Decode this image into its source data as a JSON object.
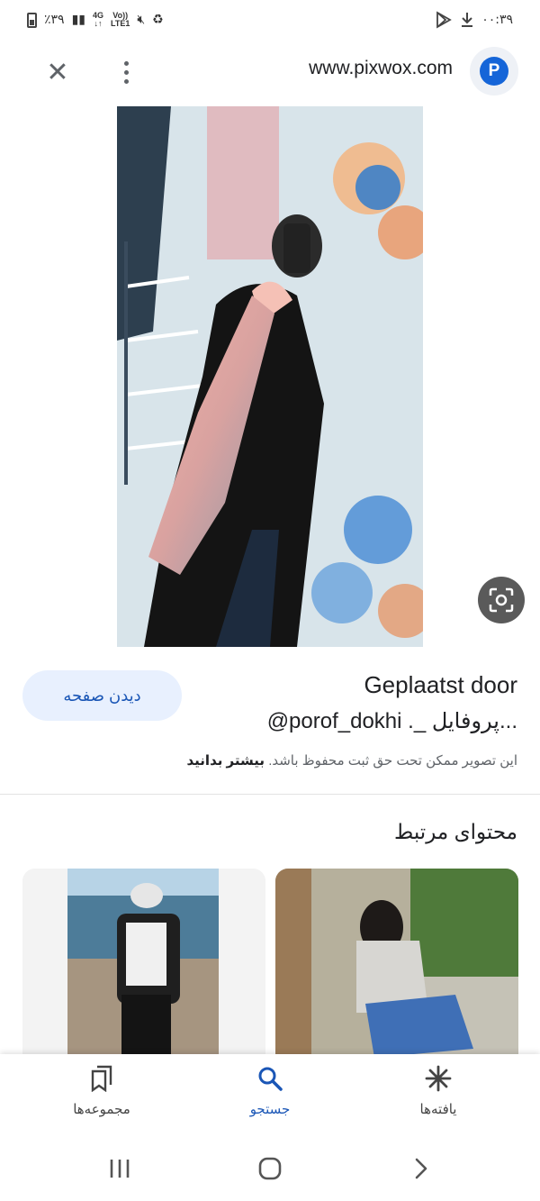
{
  "status_bar": {
    "battery_percent": "٪۳۹",
    "network": "4G",
    "carrier": "LTE1",
    "volte": "Vo))",
    "time": "۰۰:۳۹"
  },
  "browser": {
    "url": "www.pixwox.com",
    "favicon_letter": "P"
  },
  "result": {
    "view_page_label": "دیدن صفحه",
    "posted_by_label": "Geplaatst door",
    "handle": "@porof_dokhi ._ پروفایل...",
    "copyright_text": "این تصویر ممکن تحت حق ثبت محفوظ باشد.",
    "learn_more": "بیشتر بدانید"
  },
  "related": {
    "title": "محتوای مرتبط"
  },
  "bottom_nav": {
    "items": [
      {
        "label": "مجموعه‌ها",
        "icon": "bookmarks-icon"
      },
      {
        "label": "جستجو",
        "icon": "search-icon"
      },
      {
        "label": "یافته‌ها",
        "icon": "discover-icon"
      }
    ],
    "active_index": 1
  },
  "colors": {
    "accent": "#1a56b6",
    "accent_bg": "#e8f0fe",
    "favicon": "#1565d8"
  }
}
